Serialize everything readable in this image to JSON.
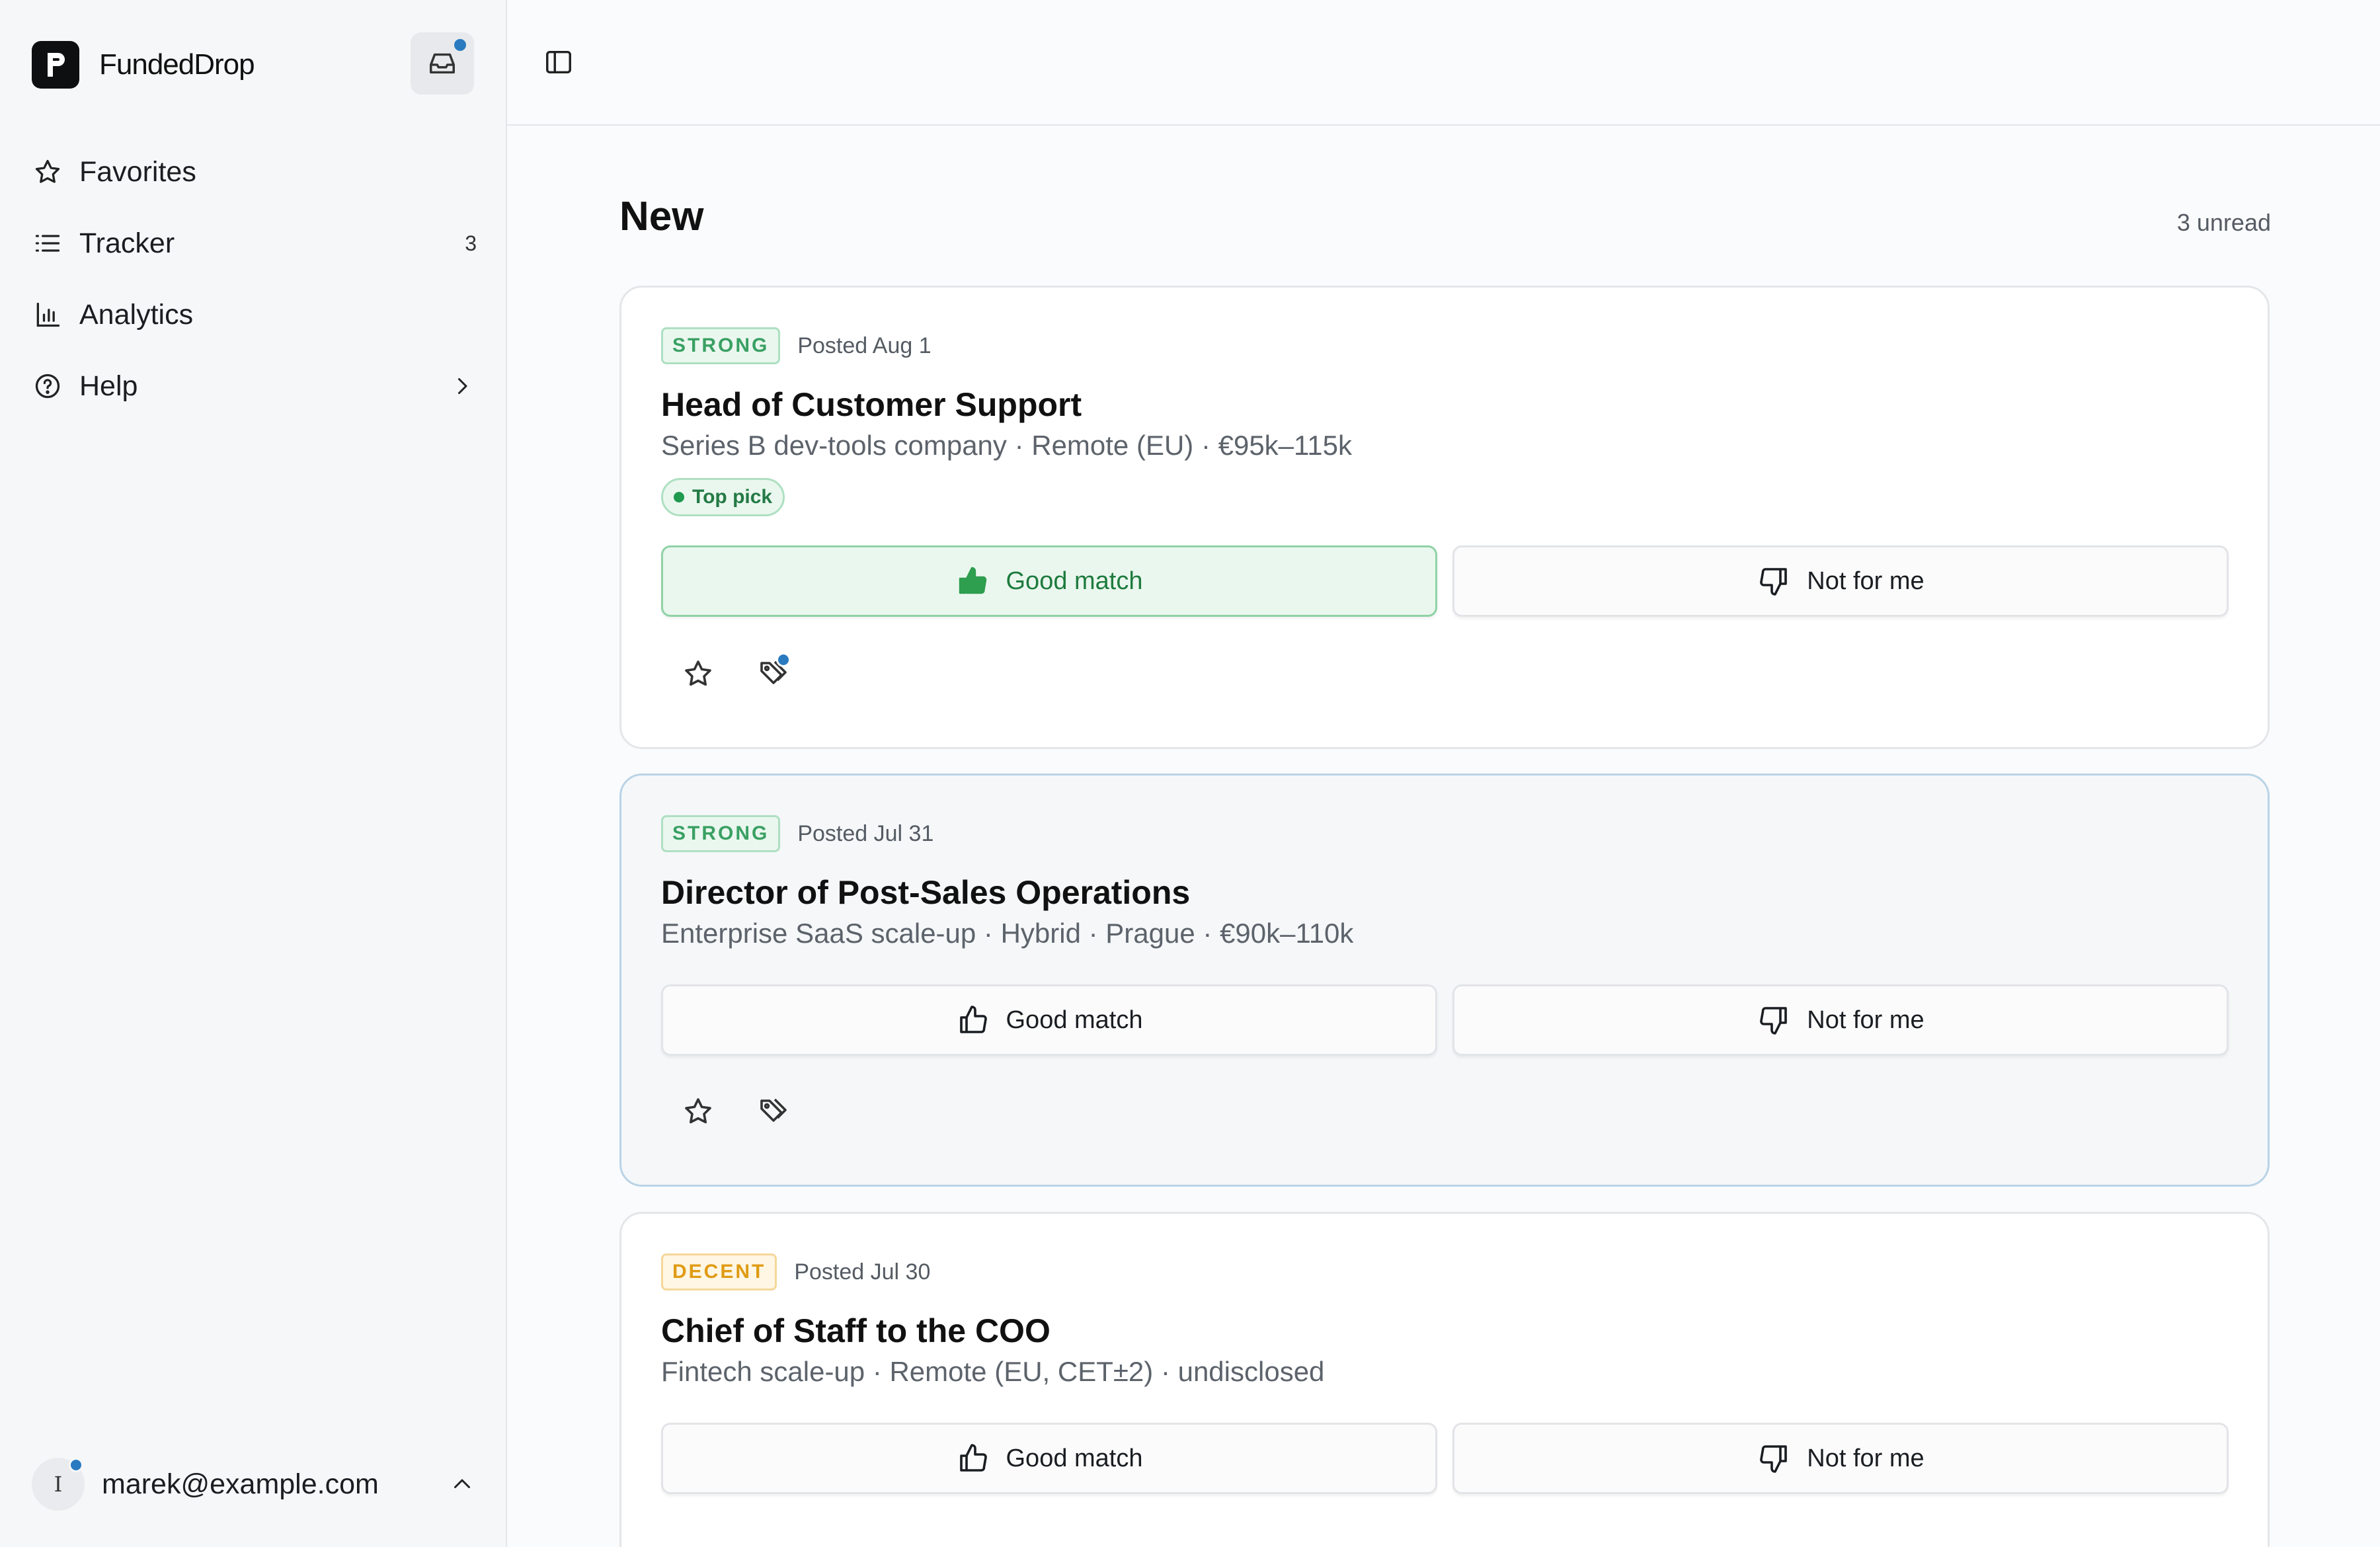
{
  "sidebar": {
    "brand": "FundedDrop",
    "nav": [
      {
        "label": "Favorites",
        "icon": "star-icon"
      },
      {
        "label": "Tracker",
        "icon": "list-icon",
        "count": "3"
      },
      {
        "label": "Analytics",
        "icon": "bar-chart-icon"
      },
      {
        "label": "Help",
        "icon": "help-circle-icon"
      }
    ],
    "user": {
      "initial": "I",
      "email": "marek@example.com"
    }
  },
  "main": {
    "title": "New",
    "unread": "3 unread",
    "cards": [
      {
        "badge": "STRONG",
        "posted": "Posted Aug 1",
        "title": "Head of Customer Support",
        "subtitle": "Series B dev-tools company · Remote (EU) · €95k–115k",
        "pill": "Top pick",
        "good": "Good match",
        "bad": "Not for me"
      },
      {
        "badge": "STRONG",
        "posted": "Posted Jul 31",
        "title": "Director of Post-Sales Operations",
        "subtitle": "Enterprise SaaS scale-up · Hybrid · Prague · €90k–110k",
        "good": "Good match",
        "bad": "Not for me"
      },
      {
        "badge": "DECENT",
        "posted": "Posted Jul 30",
        "title": "Chief of Staff to the COO",
        "subtitle": "Fintech scale-up · Remote (EU, CET±2) · undisclosed",
        "good": "Good match",
        "bad": "Not for me"
      }
    ]
  },
  "colors": {
    "accent_dot": "#2a7ac0",
    "strong": "#3aa063",
    "decent": "#e09b14",
    "good_active": "#1f9a4e"
  }
}
